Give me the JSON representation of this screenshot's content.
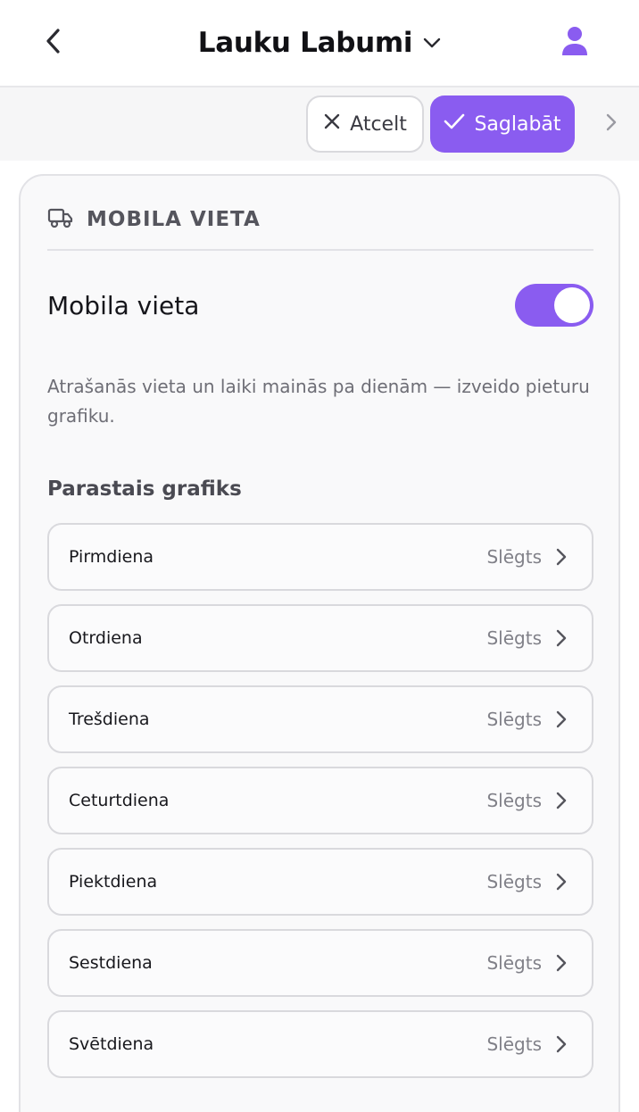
{
  "header": {
    "title": "Lauku Labumi",
    "back_icon": "chevron-left-icon",
    "caret_icon": "chevron-down-icon",
    "profile_icon": "user-icon"
  },
  "toolbar": {
    "cancel_label": "Atcelt",
    "save_label": "Saglabāt",
    "next_icon": "chevron-right-icon"
  },
  "section": {
    "icon": "truck-icon",
    "title": "MOBILA VIETA"
  },
  "mobile_toggle": {
    "label": "Mobila vieta",
    "enabled": true
  },
  "description": "Atrašanās vieta un laiki mainās pa dienām — izveido pieturu grafiku.",
  "schedule": {
    "heading": "Parastais grafiks",
    "days": [
      {
        "name": "Pirmdiena",
        "status": "Slēgts"
      },
      {
        "name": "Otrdiena",
        "status": "Slēgts"
      },
      {
        "name": "Trešdiena",
        "status": "Slēgts"
      },
      {
        "name": "Ceturtdiena",
        "status": "Slēgts"
      },
      {
        "name": "Piektdiena",
        "status": "Slēgts"
      },
      {
        "name": "Sestdiena",
        "status": "Slēgts"
      },
      {
        "name": "Svētdiena",
        "status": "Slēgts"
      }
    ]
  },
  "colors": {
    "accent": "#8a5cf0",
    "border": "#d9d9dd",
    "muted_text": "#808088"
  }
}
